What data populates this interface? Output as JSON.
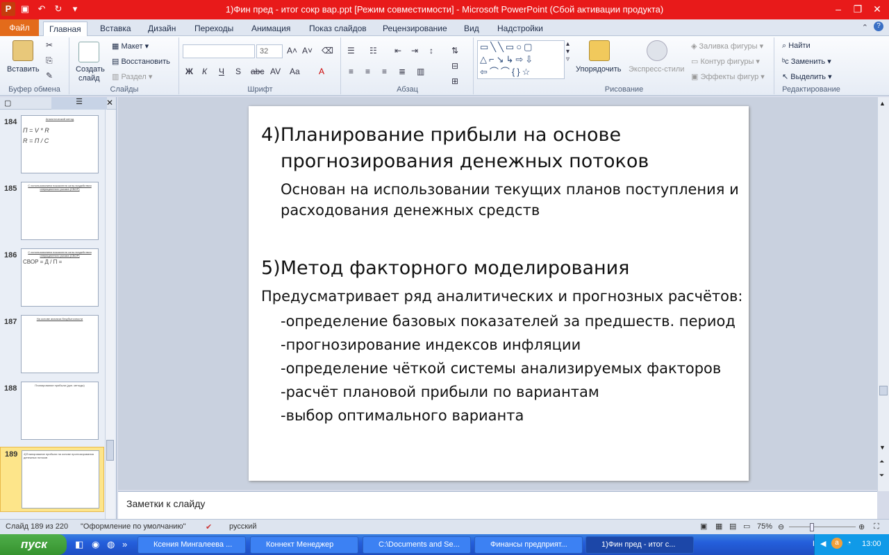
{
  "titlebar": {
    "title": "1)Фин пред - итог сокр вар.ppt [Режим совместимости] - Microsoft PowerPoint (Сбой активации продукта)"
  },
  "tabs": [
    "Главная",
    "Вставка",
    "Дизайн",
    "Переходы",
    "Анимация",
    "Показ слайдов",
    "Рецензирование",
    "Вид",
    "Надстройки"
  ],
  "file_tab": "Файл",
  "ribbon": {
    "clipboard": {
      "paste": "Вставить",
      "label": "Буфер обмена"
    },
    "slides": {
      "new_slide_1": "Создать",
      "new_slide_2": "слайд",
      "layout": "Макет",
      "reset": "Восстановить",
      "section": "Раздел",
      "label": "Слайды"
    },
    "font": {
      "size": "32",
      "label": "Шрифт"
    },
    "paragraph": {
      "label": "Абзац"
    },
    "drawing": {
      "arrange": "Упорядочить",
      "quick_styles": "Экспресс-стили",
      "fill": "Заливка фигуры",
      "outline": "Контур фигуры",
      "effects": "Эффекты фигур",
      "label": "Рисование"
    },
    "editing": {
      "find": "Найти",
      "replace": "Заменить",
      "select": "Выделить",
      "label": "Редактирование"
    }
  },
  "slides_panel": {
    "items": [
      {
        "num": "184",
        "thumb": "Аналитический метод"
      },
      {
        "num": "185",
        "thumb": "С использованием показателя силы воздействия операционного рычага (СВОР)"
      },
      {
        "num": "186",
        "thumb": "С использованием показателя силы воздействия операционного рычага (СВОР)"
      },
      {
        "num": "187",
        "thumb": "На основе анализа безубыточности"
      },
      {
        "num": "188",
        "thumb": "Планирование прибыли (доп. методы)"
      },
      {
        "num": "189",
        "thumb": "4)Планирование прибыли на основе прогнозирования денежных потоков"
      }
    ]
  },
  "slide": {
    "heading4_line1": "4)Планирование прибыли на основе",
    "heading4_line2": "прогнозирования денежных потоков",
    "text4_line1": "Основан на использовании текущих планов поступления и",
    "text4_line2": "расходования денежных средств",
    "heading5": "5)Метод факторного моделирования",
    "text5": "Предусматривает ряд аналитических и прогнозных расчётов:",
    "bullets": [
      "-определение базовых показателей за предшеств. период",
      "-прогнозирование индексов инфляции",
      "-определение чёткой системы анализируемых факторов",
      "-расчёт плановой прибыли по вариантам",
      "-выбор оптимального варианта"
    ]
  },
  "notes": "Заметки к слайду",
  "status": {
    "slide_info": "Слайд 189 из 220",
    "theme": "\"Оформление по умолчанию\"",
    "language": "русский",
    "zoom": "75%"
  },
  "taskbar": {
    "start": "пуск",
    "tasks": [
      "Ксения Мингалеева ...",
      "Коннект Менеджер",
      "C:\\Documents and Se...",
      "Финансы предприят...",
      "1)Фин пред - итог с..."
    ],
    "lang": "EN",
    "time": "13:00"
  }
}
